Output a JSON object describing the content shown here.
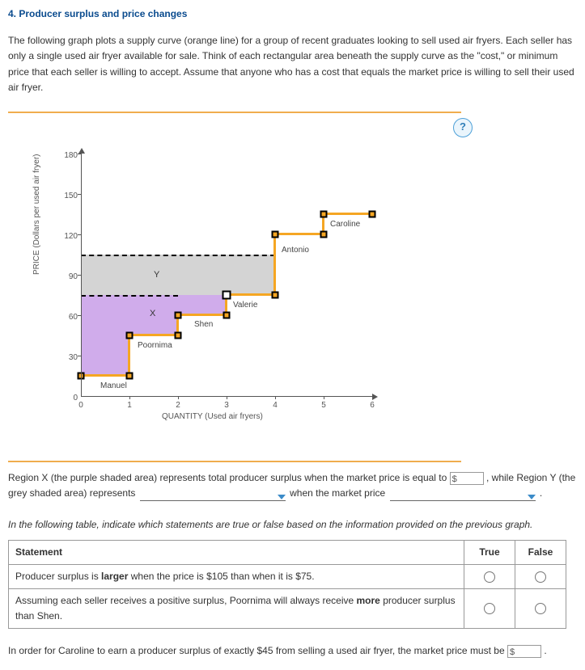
{
  "title": "4. Producer surplus and price changes",
  "intro": "The following graph plots a supply curve (orange line) for a group of recent graduates looking to sell used air fryers. Each seller has only a single used air fryer available for sale. Think of each rectangular area beneath the supply curve as the \"cost,\" or minimum price that each seller is willing to accept. Assume that anyone who has a cost that equals the market price is willing to sell their used air fryer.",
  "help": "?",
  "chart_data": {
    "type": "line",
    "title": "",
    "xlabel": "QUANTITY (Used air fryers)",
    "ylabel": "PRICE (Dollars per used air fryer)",
    "xlim": [
      0,
      6
    ],
    "ylim": [
      0,
      180
    ],
    "xticks": [
      0,
      1,
      2,
      3,
      4,
      5,
      6
    ],
    "yticks": [
      0,
      30,
      60,
      90,
      120,
      150,
      180
    ],
    "supply_steps": [
      {
        "seller": "Manuel",
        "q_from": 0,
        "q_to": 1,
        "cost": 15
      },
      {
        "seller": "Poornima",
        "q_from": 1,
        "q_to": 2,
        "cost": 45
      },
      {
        "seller": "Shen",
        "q_from": 2,
        "q_to": 3,
        "cost": 60
      },
      {
        "seller": "Valerie",
        "q_from": 3,
        "q_to": 4,
        "cost": 75
      },
      {
        "seller": "Antonio",
        "q_from": 4,
        "q_to": 5,
        "cost": 120
      },
      {
        "seller": "Caroline",
        "q_from": 5,
        "q_to": 6,
        "cost": 135
      }
    ],
    "price_line_x": {
      "price": 75,
      "label": "X",
      "q_extent": 4,
      "region": "purple"
    },
    "price_line_y": {
      "price": 105,
      "label": "Y",
      "q_extent": 4,
      "region": "grey"
    },
    "drag_handle": {
      "q": 3,
      "price": 75
    }
  },
  "para1_a": "Region X (the purple shaded area) represents total producer surplus when the market price is equal to ",
  "para1_b": ", while Region Y (the grey shaded area) represents ",
  "para1_c": " when the market price ",
  "para1_d": " .",
  "instruction": "In the following table, indicate which statements are true or false based on the information provided on the previous graph.",
  "table": {
    "headers": [
      "Statement",
      "True",
      "False"
    ],
    "rows": [
      "Producer surplus is larger when the price is $105 than when it is $75.",
      "Assuming each seller receives a positive surplus, Poornima will always receive more producer surplus than Shen."
    ],
    "row1_pre": "Producer surplus is ",
    "row1_bold": "larger",
    "row1_post": " when the price is $105 than when it is $75.",
    "row2_pre": "Assuming each seller receives a positive surplus, Poornima will always receive ",
    "row2_bold": "more",
    "row2_post": " producer surplus than Shen."
  },
  "final_a": "In order for Caroline to earn a producer surplus of exactly $45 from selling a used air fryer, the market price must be ",
  "final_b": " ."
}
